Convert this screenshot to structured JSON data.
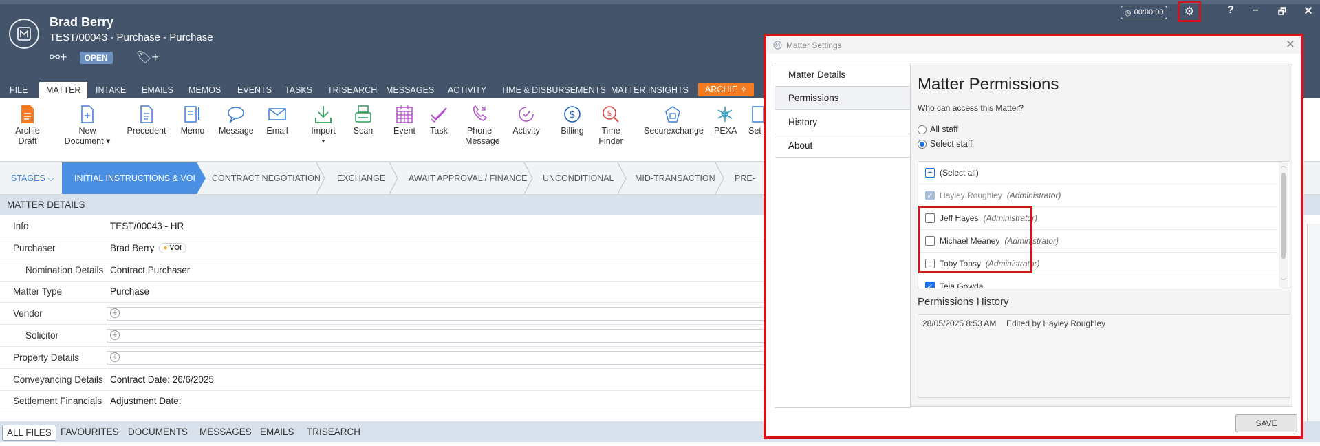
{
  "header": {
    "client_name": "Brad Berry",
    "matter_ref": "TEST/00043 - Purchase - Purchase",
    "status": "OPEN",
    "timer": "00:00:00",
    "help": "?",
    "minimize": "–",
    "restore": "🗗",
    "close": "✕"
  },
  "tabs": [
    "FILE",
    "MATTER",
    "INTAKE",
    "EMAILS",
    "MEMOS",
    "EVENTS",
    "TASKS",
    "TRISEARCH",
    "MESSAGES",
    "ACTIVITY",
    "TIME & DISBURSEMENTS",
    "MATTER INSIGHTS",
    "ARCHIE"
  ],
  "ribbon": {
    "archie_draft": [
      "Archie",
      "Draft"
    ],
    "new_document": [
      "New",
      "Document ▾"
    ],
    "precedent": "Precedent",
    "memo": "Memo",
    "message": "Message",
    "email": "Email",
    "import": [
      "Import",
      "▾"
    ],
    "scan": "Scan",
    "event": "Event",
    "task": "Task",
    "phone_message": [
      "Phone",
      "Message"
    ],
    "activity": "Activity",
    "billing": "Billing",
    "time_finder": [
      "Time",
      "Finder"
    ],
    "securexchange": "Securexchange",
    "pexa": "PEXA",
    "settings_partial": "Set"
  },
  "stages": {
    "toggle": "STAGES",
    "items": [
      "INITIAL INSTRUCTIONS & VOI",
      "CONTRACT NEGOTIATION",
      "EXCHANGE",
      "AWAIT APPROVAL / FINANCE",
      "UNCONDITIONAL",
      "MID-TRANSACTION",
      "PRE-SET"
    ]
  },
  "matter_details": {
    "heading": "MATTER DETAILS",
    "rows": [
      {
        "label": "Info",
        "value": "TEST/00043 - HR"
      },
      {
        "label": "Purchaser",
        "value": "Brad Berry",
        "badge": "VOI"
      },
      {
        "label": "Nomination Details",
        "value": "Contract Purchaser"
      },
      {
        "label": "Matter Type",
        "value": "Purchase"
      },
      {
        "label": "Vendor",
        "value": ""
      },
      {
        "label": "Solicitor",
        "value": ""
      },
      {
        "label": "Property Details",
        "value": ""
      },
      {
        "label": "Conveyancing Details",
        "value": "Contract Date: 26/6/2025"
      },
      {
        "label": "Settlement Financials",
        "value": "Adjustment Date:"
      }
    ]
  },
  "bottom_tabs": [
    "ALL FILES",
    "FAVOURITES",
    "DOCUMENTS",
    "MESSAGES",
    "EMAILS",
    "TRISEARCH"
  ],
  "dialog": {
    "title": "Matter Settings",
    "close": "✕",
    "sidebar": [
      "Matter Details",
      "Permissions",
      "History",
      "About"
    ],
    "active_sidebar": "Permissions",
    "heading": "Matter Permissions",
    "question": "Who can access this Matter?",
    "options": {
      "all_staff": "All staff",
      "select_staff": "Select staff",
      "selected": "select_staff"
    },
    "select_all": "(Select all)",
    "staff": [
      {
        "name": "Hayley Roughley",
        "role": "(Administrator)",
        "checked": true,
        "disabled": true
      },
      {
        "name": "Jeff Hayes",
        "role": "(Administrator)",
        "checked": false,
        "disabled": false
      },
      {
        "name": "Michael Meaney",
        "role": "(Administrator)",
        "checked": false,
        "disabled": false
      },
      {
        "name": "Toby Topsy",
        "role": "(Administrator)",
        "checked": false,
        "disabled": false
      },
      {
        "name": "Teja Gowda",
        "role": "",
        "checked": true,
        "disabled": false
      }
    ],
    "history_title": "Permissions History",
    "history": [
      {
        "date": "28/05/2025 8:53 AM",
        "by": "Edited by Hayley Roughley"
      }
    ],
    "save": "SAVE"
  },
  "colors": {
    "header": "#44546a",
    "accent": "#4a8fe2",
    "highlight": "#d0141d",
    "archie": "#f47b20",
    "icon_blue": "#3d7fd8"
  }
}
